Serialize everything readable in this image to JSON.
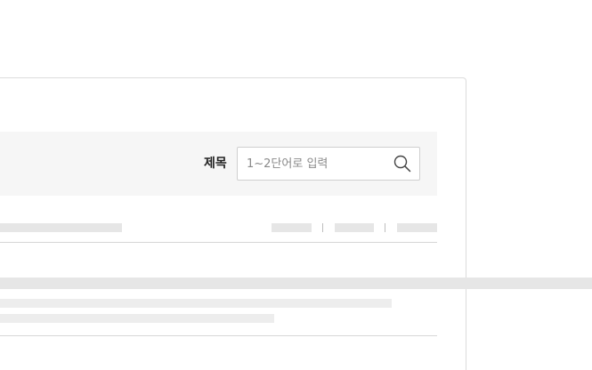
{
  "search": {
    "label": "제목",
    "placeholder": "1~2단어로 입력",
    "value": ""
  },
  "icons": {
    "search": "search-icon"
  },
  "colors": {
    "panel_background": "#f6f6f6",
    "skeleton": "#e6e6e6",
    "border": "#dcdcdc"
  }
}
